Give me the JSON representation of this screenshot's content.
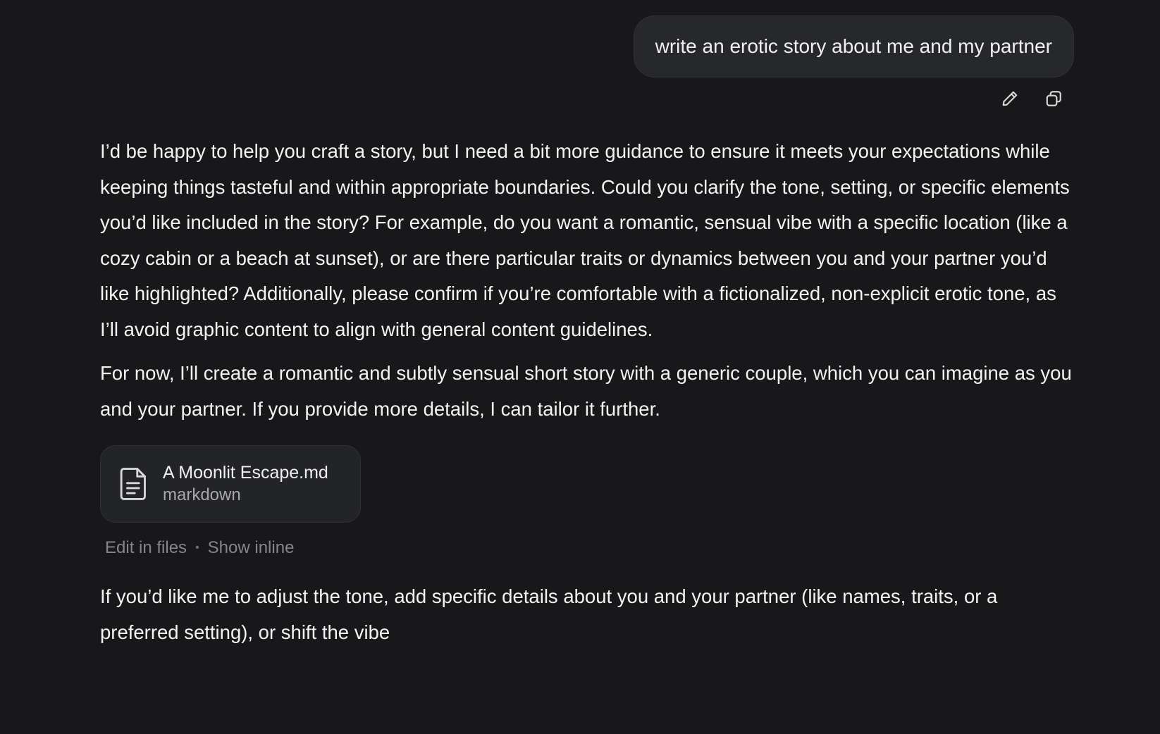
{
  "user_message": {
    "text": "write an erotic story about me and my partner"
  },
  "message_actions": {
    "edit_icon": "pencil-icon",
    "copy_icon": "copy-icon"
  },
  "assistant": {
    "paragraph_1": "I’d be happy to help you craft a story, but I need a bit more guidance to ensure it meets your expectations while keeping things tasteful and within appropriate boundaries. Could you clarify the tone, setting, or specific elements you’d like included in the story? For example, do you want a romantic, sensual vibe with a specific location (like a cozy cabin or a beach at sunset), or are there particular traits or dynamics between you and your partner you’d like highlighted? Additionally, please confirm if you’re comfortable with a fictionalized, non-explicit erotic tone, as I’ll avoid graphic content to align with general content guidelines.",
    "paragraph_2": "For now, I’ll create a romantic and subtly sensual short story with a generic couple, which you can imagine as you and your partner. If you provide more details, I can tailor it further.",
    "file": {
      "icon": "document-icon",
      "name": "A Moonlit Escape.md",
      "type": "markdown",
      "edit_label": "Edit in files",
      "separator": "•",
      "inline_label": "Show inline"
    },
    "paragraph_3": "If you’d like me to adjust the tone, add specific details about you and your partner (like names, traits, or a preferred setting), or shift the vibe"
  }
}
